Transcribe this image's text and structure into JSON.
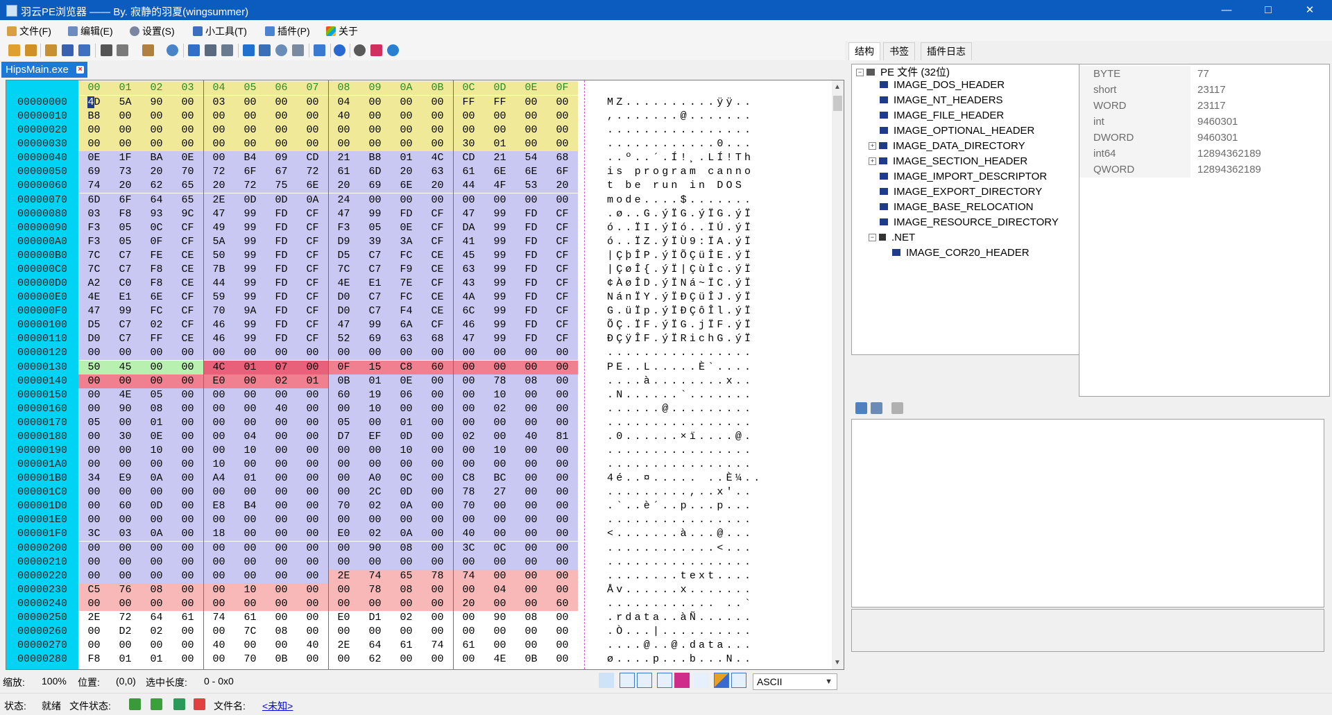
{
  "window": {
    "title": "羽云PE浏览器 —— By. 寂静的羽夏(wingsummer)",
    "minimize": "—",
    "maximize": "□",
    "close": "✕"
  },
  "menu": [
    {
      "label": "文件(F)",
      "icon": "file-icon"
    },
    {
      "label": "编辑(E)",
      "icon": "edit-icon"
    },
    {
      "label": "设置(S)",
      "icon": "gear-icon"
    },
    {
      "label": "小工具(T)",
      "icon": "tool-icon"
    },
    {
      "label": "插件(P)",
      "icon": "plugin-icon"
    },
    {
      "label": "关于",
      "icon": "about-icon"
    }
  ],
  "doc_tab": {
    "label": "HipsMain.exe",
    "close": "×"
  },
  "hex": {
    "header": [
      "00",
      "01",
      "02",
      "03",
      "04",
      "05",
      "06",
      "07",
      "08",
      "09",
      "0A",
      "0B",
      "0C",
      "0D",
      "0E",
      "0F"
    ],
    "rows": [
      {
        "addr": "00000000",
        "bytes": [
          "4D",
          "5A",
          "90",
          "00",
          "03",
          "00",
          "00",
          "00",
          "04",
          "00",
          "00",
          "00",
          "FF",
          "FF",
          "00",
          "00"
        ],
        "ascii": "MZ..........ÿÿ.."
      },
      {
        "addr": "00000010",
        "bytes": [
          "B8",
          "00",
          "00",
          "00",
          "00",
          "00",
          "00",
          "00",
          "40",
          "00",
          "00",
          "00",
          "00",
          "00",
          "00",
          "00"
        ],
        "ascii": ",.......@......."
      },
      {
        "addr": "00000020",
        "bytes": [
          "00",
          "00",
          "00",
          "00",
          "00",
          "00",
          "00",
          "00",
          "00",
          "00",
          "00",
          "00",
          "00",
          "00",
          "00",
          "00"
        ],
        "ascii": "................"
      },
      {
        "addr": "00000030",
        "bytes": [
          "00",
          "00",
          "00",
          "00",
          "00",
          "00",
          "00",
          "00",
          "00",
          "00",
          "00",
          "00",
          "30",
          "01",
          "00",
          "00"
        ],
        "ascii": "............0..."
      },
      {
        "addr": "00000040",
        "bytes": [
          "0E",
          "1F",
          "BA",
          "0E",
          "00",
          "B4",
          "09",
          "CD",
          "21",
          "B8",
          "01",
          "4C",
          "CD",
          "21",
          "54",
          "68"
        ],
        "ascii": "..º..´.Í!¸.LÍ!Th"
      },
      {
        "addr": "00000050",
        "bytes": [
          "69",
          "73",
          "20",
          "70",
          "72",
          "6F",
          "67",
          "72",
          "61",
          "6D",
          "20",
          "63",
          "61",
          "6E",
          "6E",
          "6F"
        ],
        "ascii": "is program canno"
      },
      {
        "addr": "00000060",
        "bytes": [
          "74",
          "20",
          "62",
          "65",
          "20",
          "72",
          "75",
          "6E",
          "20",
          "69",
          "6E",
          "20",
          "44",
          "4F",
          "53",
          "20"
        ],
        "ascii": "t be run in DOS "
      },
      {
        "addr": "00000070",
        "bytes": [
          "6D",
          "6F",
          "64",
          "65",
          "2E",
          "0D",
          "0D",
          "0A",
          "24",
          "00",
          "00",
          "00",
          "00",
          "00",
          "00",
          "00"
        ],
        "ascii": "mode....$......."
      },
      {
        "addr": "00000080",
        "bytes": [
          "03",
          "F8",
          "93",
          "9C",
          "47",
          "99",
          "FD",
          "CF",
          "47",
          "99",
          "FD",
          "CF",
          "47",
          "99",
          "FD",
          "CF"
        ],
        "ascii": ".ø..G.ýÏG.ýÏG.ýÏ"
      },
      {
        "addr": "00000090",
        "bytes": [
          "F3",
          "05",
          "0C",
          "CF",
          "49",
          "99",
          "FD",
          "CF",
          "F3",
          "05",
          "0E",
          "CF",
          "DA",
          "99",
          "FD",
          "CF"
        ],
        "ascii": "ó..ÏI.ýÏó..ÏÚ.ýÏ"
      },
      {
        "addr": "000000A0",
        "bytes": [
          "F3",
          "05",
          "0F",
          "CF",
          "5A",
          "99",
          "FD",
          "CF",
          "D9",
          "39",
          "3A",
          "CF",
          "41",
          "99",
          "FD",
          "CF"
        ],
        "ascii": "ó..ÏZ.ýÏÙ9:ÏA.ýÏ"
      },
      {
        "addr": "000000B0",
        "bytes": [
          "7C",
          "C7",
          "FE",
          "CE",
          "50",
          "99",
          "FD",
          "CF",
          "D5",
          "C7",
          "FC",
          "CE",
          "45",
          "99",
          "FD",
          "CF"
        ],
        "ascii": "|ÇþÎP.ýÏÕÇüÎE.ýÏ"
      },
      {
        "addr": "000000C0",
        "bytes": [
          "7C",
          "C7",
          "F8",
          "CE",
          "7B",
          "99",
          "FD",
          "CF",
          "7C",
          "C7",
          "F9",
          "CE",
          "63",
          "99",
          "FD",
          "CF"
        ],
        "ascii": "|ÇøÎ{.ýÏ|ÇùÎc.ýÏ"
      },
      {
        "addr": "000000D0",
        "bytes": [
          "A2",
          "C0",
          "F8",
          "CE",
          "44",
          "99",
          "FD",
          "CF",
          "4E",
          "E1",
          "7E",
          "CF",
          "43",
          "99",
          "FD",
          "CF"
        ],
        "ascii": "¢ÀøÎD.ýÏNá~ÏC.ýÏ"
      },
      {
        "addr": "000000E0",
        "bytes": [
          "4E",
          "E1",
          "6E",
          "CF",
          "59",
          "99",
          "FD",
          "CF",
          "D0",
          "C7",
          "FC",
          "CE",
          "4A",
          "99",
          "FD",
          "CF"
        ],
        "ascii": "NánÏY.ýÏÐÇüÎJ.ýÏ"
      },
      {
        "addr": "000000F0",
        "bytes": [
          "47",
          "99",
          "FC",
          "CF",
          "70",
          "9A",
          "FD",
          "CF",
          "D0",
          "C7",
          "F4",
          "CE",
          "6C",
          "99",
          "FD",
          "CF"
        ],
        "ascii": "G.üÏp.ýÏÐÇôÎl.ýÏ"
      },
      {
        "addr": "00000100",
        "bytes": [
          "D5",
          "C7",
          "02",
          "CF",
          "46",
          "99",
          "FD",
          "CF",
          "47",
          "99",
          "6A",
          "CF",
          "46",
          "99",
          "FD",
          "CF"
        ],
        "ascii": "ÕÇ.ÏF.ýÏG.jÏF.ýÏ"
      },
      {
        "addr": "00000110",
        "bytes": [
          "D0",
          "C7",
          "FF",
          "CE",
          "46",
          "99",
          "FD",
          "CF",
          "52",
          "69",
          "63",
          "68",
          "47",
          "99",
          "FD",
          "CF"
        ],
        "ascii": "ÐÇÿÎF.ýÏRichG.ýÏ"
      },
      {
        "addr": "00000120",
        "bytes": [
          "00",
          "00",
          "00",
          "00",
          "00",
          "00",
          "00",
          "00",
          "00",
          "00",
          "00",
          "00",
          "00",
          "00",
          "00",
          "00"
        ],
        "ascii": "................"
      },
      {
        "addr": "00000130",
        "bytes": [
          "50",
          "45",
          "00",
          "00",
          "4C",
          "01",
          "07",
          "00",
          "0F",
          "15",
          "C8",
          "60",
          "00",
          "00",
          "00",
          "00"
        ],
        "ascii": "PE..L.....È`...."
      },
      {
        "addr": "00000140",
        "bytes": [
          "00",
          "00",
          "00",
          "00",
          "E0",
          "00",
          "02",
          "01",
          "0B",
          "01",
          "0E",
          "00",
          "00",
          "78",
          "08",
          "00"
        ],
        "ascii": "....à........x.."
      },
      {
        "addr": "00000150",
        "bytes": [
          "00",
          "4E",
          "05",
          "00",
          "00",
          "00",
          "00",
          "00",
          "60",
          "19",
          "06",
          "00",
          "00",
          "10",
          "00",
          "00"
        ],
        "ascii": ".N......`......."
      },
      {
        "addr": "00000160",
        "bytes": [
          "00",
          "90",
          "08",
          "00",
          "00",
          "00",
          "40",
          "00",
          "00",
          "10",
          "00",
          "00",
          "00",
          "02",
          "00",
          "00"
        ],
        "ascii": "......@........."
      },
      {
        "addr": "00000170",
        "bytes": [
          "05",
          "00",
          "01",
          "00",
          "00",
          "00",
          "00",
          "00",
          "05",
          "00",
          "01",
          "00",
          "00",
          "00",
          "00",
          "00"
        ],
        "ascii": "................"
      },
      {
        "addr": "00000180",
        "bytes": [
          "00",
          "30",
          "0E",
          "00",
          "00",
          "04",
          "00",
          "00",
          "D7",
          "EF",
          "0D",
          "00",
          "02",
          "00",
          "40",
          "81"
        ],
        "ascii": ".0......×ï....@."
      },
      {
        "addr": "00000190",
        "bytes": [
          "00",
          "00",
          "10",
          "00",
          "00",
          "10",
          "00",
          "00",
          "00",
          "00",
          "10",
          "00",
          "00",
          "10",
          "00",
          "00"
        ],
        "ascii": "................"
      },
      {
        "addr": "000001A0",
        "bytes": [
          "00",
          "00",
          "00",
          "00",
          "10",
          "00",
          "00",
          "00",
          "00",
          "00",
          "00",
          "00",
          "00",
          "00",
          "00",
          "00"
        ],
        "ascii": "................"
      },
      {
        "addr": "000001B0",
        "bytes": [
          "34",
          "E9",
          "0A",
          "00",
          "A4",
          "01",
          "00",
          "00",
          "00",
          "A0",
          "0C",
          "00",
          "C8",
          "BC",
          "00",
          "00"
        ],
        "ascii": "4é..¤..... ..È¼.."
      },
      {
        "addr": "000001C0",
        "bytes": [
          "00",
          "00",
          "00",
          "00",
          "00",
          "00",
          "00",
          "00",
          "00",
          "2C",
          "0D",
          "00",
          "78",
          "27",
          "00",
          "00"
        ],
        "ascii": ".........,..x'.."
      },
      {
        "addr": "000001D0",
        "bytes": [
          "00",
          "60",
          "0D",
          "00",
          "E8",
          "B4",
          "00",
          "00",
          "70",
          "02",
          "0A",
          "00",
          "70",
          "00",
          "00",
          "00"
        ],
        "ascii": ".`..è´..p...p..."
      },
      {
        "addr": "000001E0",
        "bytes": [
          "00",
          "00",
          "00",
          "00",
          "00",
          "00",
          "00",
          "00",
          "00",
          "00",
          "00",
          "00",
          "00",
          "00",
          "00",
          "00"
        ],
        "ascii": "................"
      },
      {
        "addr": "000001F0",
        "bytes": [
          "3C",
          "03",
          "0A",
          "00",
          "18",
          "00",
          "00",
          "00",
          "E0",
          "02",
          "0A",
          "00",
          "40",
          "00",
          "00",
          "00"
        ],
        "ascii": "<.......à...@..."
      },
      {
        "addr": "00000200",
        "bytes": [
          "00",
          "00",
          "00",
          "00",
          "00",
          "00",
          "00",
          "00",
          "00",
          "90",
          "08",
          "00",
          "3C",
          "0C",
          "00",
          "00"
        ],
        "ascii": "............<..."
      },
      {
        "addr": "00000210",
        "bytes": [
          "00",
          "00",
          "00",
          "00",
          "00",
          "00",
          "00",
          "00",
          "00",
          "00",
          "00",
          "00",
          "00",
          "00",
          "00",
          "00"
        ],
        "ascii": "................"
      },
      {
        "addr": "00000220",
        "bytes": [
          "00",
          "00",
          "00",
          "00",
          "00",
          "00",
          "00",
          "00",
          "2E",
          "74",
          "65",
          "78",
          "74",
          "00",
          "00",
          "00"
        ],
        "ascii": "........text...."
      },
      {
        "addr": "00000230",
        "bytes": [
          "C5",
          "76",
          "08",
          "00",
          "00",
          "10",
          "00",
          "00",
          "00",
          "78",
          "08",
          "00",
          "00",
          "04",
          "00",
          "00"
        ],
        "ascii": "Åv......x......."
      },
      {
        "addr": "00000240",
        "bytes": [
          "00",
          "00",
          "00",
          "00",
          "00",
          "00",
          "00",
          "00",
          "00",
          "00",
          "00",
          "00",
          "20",
          "00",
          "00",
          "60"
        ],
        "ascii": "............ ..`"
      },
      {
        "addr": "00000250",
        "bytes": [
          "2E",
          "72",
          "64",
          "61",
          "74",
          "61",
          "00",
          "00",
          "E0",
          "D1",
          "02",
          "00",
          "00",
          "90",
          "08",
          "00"
        ],
        "ascii": ".rdata..àÑ......"
      },
      {
        "addr": "00000260",
        "bytes": [
          "00",
          "D2",
          "02",
          "00",
          "00",
          "7C",
          "08",
          "00",
          "00",
          "00",
          "00",
          "00",
          "00",
          "00",
          "00",
          "00"
        ],
        "ascii": ".Ò...|.........."
      },
      {
        "addr": "00000270",
        "bytes": [
          "00",
          "00",
          "00",
          "00",
          "40",
          "00",
          "00",
          "40",
          "2E",
          "64",
          "61",
          "74",
          "61",
          "00",
          "00",
          "00"
        ],
        "ascii": "....@..@.data..."
      },
      {
        "addr": "00000280",
        "bytes": [
          "F8",
          "01",
          "01",
          "00",
          "00",
          "70",
          "0B",
          "00",
          "00",
          "62",
          "00",
          "00",
          "00",
          "4E",
          "0B",
          "00"
        ],
        "ascii": "ø....p...b...N.."
      }
    ]
  },
  "colors": {
    "address_bg": "#00D3F3",
    "dos_header": "#F0EA98",
    "dos_stub": "#C8C8F2",
    "pe_sig": "#B8F0B0",
    "file_header": "#E8607A",
    "file_header_light": "#F08090",
    "optional_header": "#C8C8F2",
    "section_header": "#F8B8B8",
    "selection": "#1F3C8C"
  },
  "status1": {
    "zoom_label": "缩放:",
    "zoom_value": "100%",
    "pos_label": "位置:",
    "pos_value": "(0,0)",
    "sel_label": "选中长度:",
    "sel_value": "0 - 0x0",
    "encoding": "ASCII"
  },
  "status2": {
    "state_label": "状态:",
    "state_value": "就绪",
    "file_state_label": "文件状态:",
    "file_name_label": "文件名:",
    "file_name_value": "<未知>"
  },
  "right_tabs": [
    "结构",
    "书签",
    "插件日志"
  ],
  "tree": {
    "root": "PE 文件 (32位)",
    "items": [
      "IMAGE_DOS_HEADER",
      "IMAGE_NT_HEADERS",
      "IMAGE_FILE_HEADER",
      "IMAGE_OPTIONAL_HEADER",
      "IMAGE_DATA_DIRECTORY",
      "IMAGE_SECTION_HEADER",
      "IMAGE_IMPORT_DESCRIPTOR",
      "IMAGE_EXPORT_DIRECTORY",
      "IMAGE_BASE_RELOCATION",
      "IMAGE_RESOURCE_DIRECTORY"
    ],
    "net": ".NET",
    "net_child": "IMAGE_COR20_HEADER"
  },
  "props": [
    {
      "k": "BYTE",
      "v": "77"
    },
    {
      "k": "short",
      "v": "23117"
    },
    {
      "k": "WORD",
      "v": "23117"
    },
    {
      "k": "int",
      "v": "9460301"
    },
    {
      "k": "DWORD",
      "v": "9460301"
    },
    {
      "k": "int64",
      "v": "12894362189"
    },
    {
      "k": "QWORD",
      "v": "12894362189"
    }
  ]
}
